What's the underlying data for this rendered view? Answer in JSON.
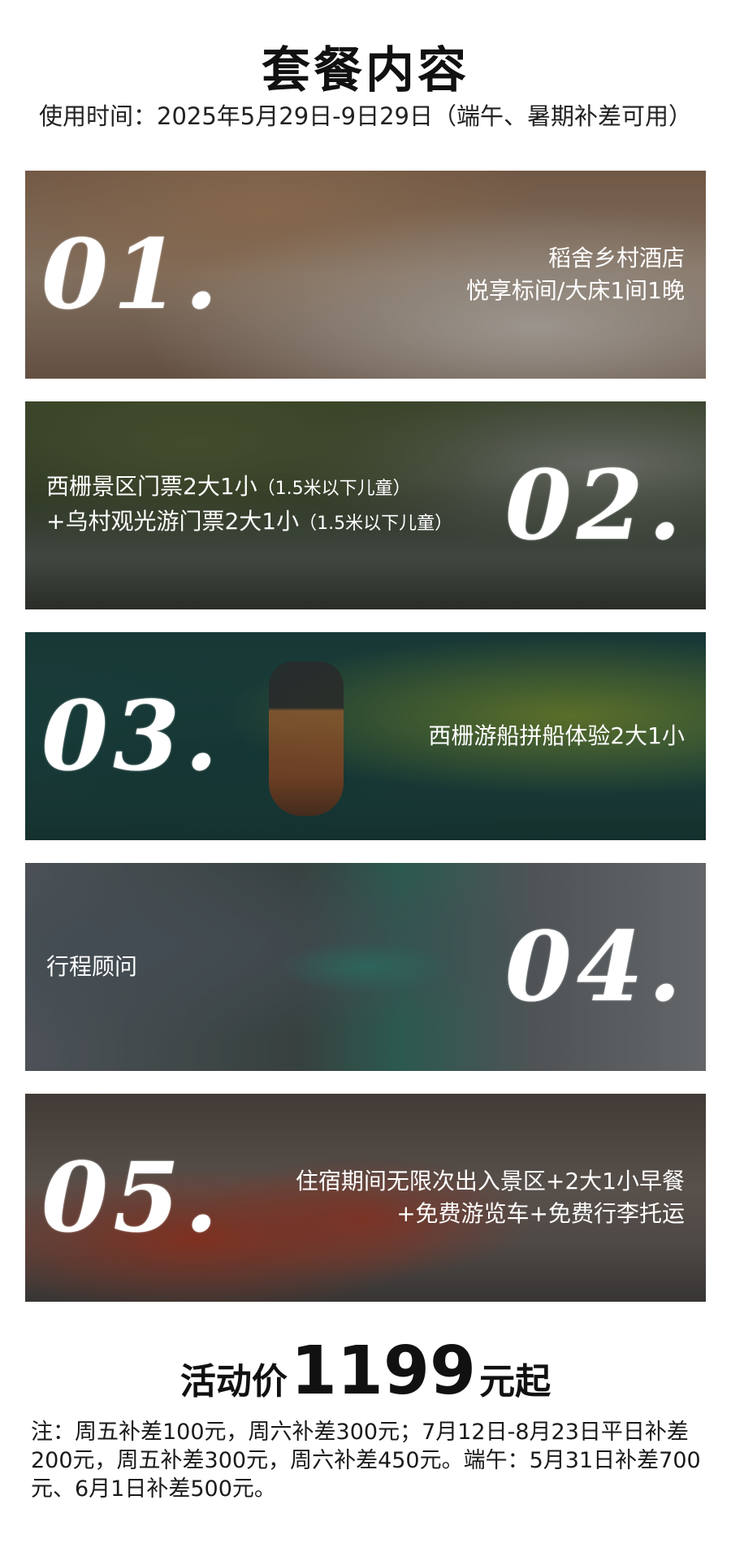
{
  "title": "套餐内容",
  "usage_time": "使用时间：2025年5月29日-9日29日（端午、暑期补差可用）",
  "items": [
    {
      "number": "01.",
      "lines": [
        "稻舍乡村酒店",
        "悦享标间/大床1间1晚"
      ]
    },
    {
      "number": "02.",
      "line1_main": "西栅景区门票2大1小",
      "line1_note": "（1.5米以下儿童）",
      "line2_main": "+乌村观光游门票2大1小",
      "line2_note": "（1.5米以下儿童）"
    },
    {
      "number": "03.",
      "lines": [
        "西栅游船拼船体验2大1小"
      ]
    },
    {
      "number": "04.",
      "lines": [
        "行程顾问"
      ]
    },
    {
      "number": "05.",
      "lines": [
        "住宿期间无限次出入景区+2大1小早餐",
        "+免费游览车+免费行李托运"
      ]
    }
  ],
  "price": {
    "label": "活动价",
    "value": "1199",
    "suffix": "元起"
  },
  "note": "注：周五补差100元，周六补差300元；7月12日-8月23日平日补差200元，周五补差300元，周六补差450元。端午：5月31日补差700元、6月1日补差500元。"
}
